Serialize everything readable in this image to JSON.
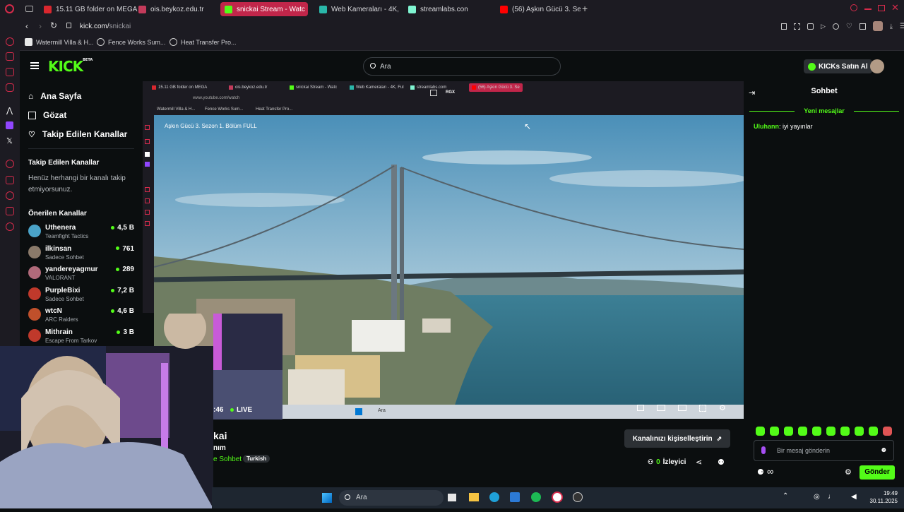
{
  "browser": {
    "tabs": [
      {
        "label": "15.11 GB folder on MEGA",
        "color": "#d9272e"
      },
      {
        "label": "ois.beykoz.edu.tr",
        "color": "#c33b5b"
      },
      {
        "label": "snickai Stream - Watc",
        "color": "#53fc18",
        "active": true
      },
      {
        "label": "Web Kameraları - 4K, Full",
        "color": "#2ab7a9"
      },
      {
        "label": "streamlabs.com",
        "color": "#80f5d2"
      },
      {
        "label": "(56) Aşkın Gücü 3. Sezon",
        "color": "#ff0000"
      }
    ],
    "url_host": "kick.com/",
    "url_path": "snickai",
    "bookmarks": [
      "Watermill Villa & H...",
      "Fence Works Sum...",
      "Heat Transfer Pro..."
    ]
  },
  "kick": {
    "logo": "KICK",
    "logo_badge": "BETA",
    "search_placeholder": "Ara",
    "buy_kicks": "KICKs Satın Al",
    "nav": {
      "home": "Ana Sayfa",
      "browse": "Gözat",
      "following": "Takip Edilen Kanallar"
    },
    "following_header": "Takip Edilen Kanallar",
    "following_empty": "Henüz herhangi bir kanalı takip etmiyorsunuz.",
    "recommended_header": "Önerilen Kanallar",
    "channels": [
      {
        "name": "Uthenera",
        "category": "Teamfight Tactics",
        "viewers": "4,5 B",
        "color": "#4aa3c8"
      },
      {
        "name": "ilkinsan",
        "category": "Sadece Sohbet",
        "viewers": "761",
        "color": "#8a7a6a"
      },
      {
        "name": "yandereyagmur",
        "category": "VALORANT",
        "viewers": "289",
        "color": "#b06a7a"
      },
      {
        "name": "PurpleBixi",
        "category": "Sadece Sohbet",
        "viewers": "7,2 B",
        "color": "#c0392b"
      },
      {
        "name": "wtcN",
        "category": "ARC Raiders",
        "viewers": "4,6 B",
        "color": "#c0502b"
      },
      {
        "name": "Mithrain",
        "category": "Escape From Tarkov",
        "viewers": "3 B",
        "color": "#c0392b"
      }
    ],
    "stream": {
      "title_partial": "kai",
      "subtitle_partial": "nım",
      "category_partial": "e Sohbet",
      "tag": "Turkish",
      "live_time": ":46",
      "live": "LIVE",
      "viewers_count": "0",
      "viewers_label": "İzleyici",
      "customize": "Kanalınızı kişiselleştirin"
    },
    "chat": {
      "header": "Sohbet",
      "new_messages": "Yeni mesajlar",
      "messages": [
        {
          "user": "Uluhann",
          "text": "iyi yayınlar"
        }
      ],
      "input_placeholder": "Bir mesaj gönderin",
      "send": "Gönder",
      "infinity": "∞"
    }
  },
  "inner": {
    "tabs": [
      "15.11 GB folder on MEGA",
      "ois.beykoz.edu.tr",
      "snickai Stream - Watc",
      "Web Kameraları - 4K, Ful",
      "streamlabs.com",
      "(56) Aşkın Gücü 3. Se"
    ],
    "url": "www.youtube.com/watch",
    "bookmarks": [
      "Watermill Villa & H...",
      "Fence Works Sum...",
      "Heat Transfer Pro..."
    ],
    "overlay_label": "RGX",
    "video_title": "Aşkın Gücü 3. Sezon 1. Bölüm FULL",
    "mini_search": "Ara"
  },
  "taskbar": {
    "search": "Ara",
    "time": "19:49",
    "date": "30.11.2025"
  }
}
